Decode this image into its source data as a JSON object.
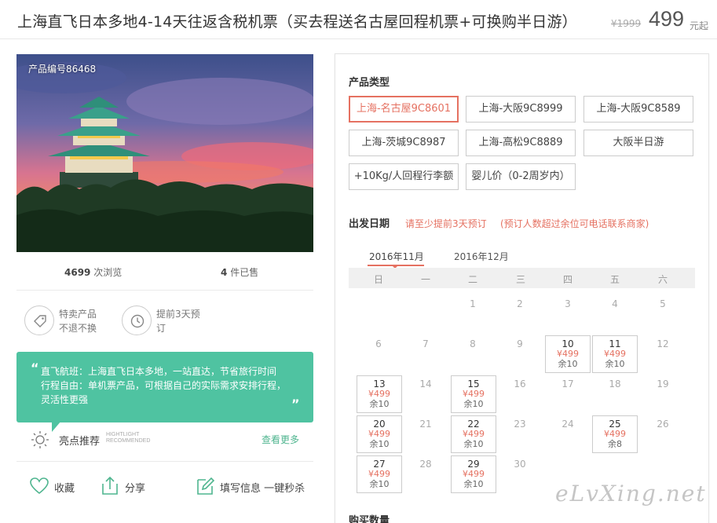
{
  "header": {
    "title": "上海直飞日本多地4-14天往返含税机票（买去程送名古屋回程机票+可换购半日游）",
    "old_price": "¥1999",
    "price": "499",
    "price_unit": "元起"
  },
  "product": {
    "number_label": "产品编号86468",
    "views_count": "4699",
    "views_label": "次浏览",
    "sold_count": "4",
    "sold_label": "件已售"
  },
  "features": [
    {
      "icon": "tag-icon",
      "line1": "特卖产品",
      "line2": "不退不换"
    },
    {
      "icon": "clock-icon",
      "line1": "提前3天预",
      "line2": "订"
    }
  ],
  "highlight": {
    "line1": "直飞航班：上海直飞日本多地，一站直达，节省旅行时间",
    "line2": "行程自由：单机票产品，可根据自己的实际需求安排行程，",
    "line3": "灵活性更强",
    "title": "亮点推荐",
    "title_en_1": "HIGHTLIGHT",
    "title_en_2": "RECOMMENDED",
    "more": "查看更多"
  },
  "actions": {
    "favorite": "收藏",
    "share": "分享",
    "fill_info": "填写信息 一键秒杀"
  },
  "booking": {
    "product_type_title": "产品类型",
    "options": [
      {
        "label": "上海-名古屋9C8601",
        "selected": true
      },
      {
        "label": "上海-大阪9C8999",
        "selected": false
      },
      {
        "label": "上海-大阪9C8589",
        "selected": false
      },
      {
        "label": "上海-茨城9C8987",
        "selected": false
      },
      {
        "label": "上海-高松9C8889",
        "selected": false
      },
      {
        "label": "大阪半日游",
        "selected": false
      },
      {
        "label": "+10Kg/人回程行李额",
        "selected": false
      },
      {
        "label": "婴儿价（0-2周岁内）",
        "selected": false
      }
    ],
    "date_title": "出发日期",
    "date_note1": "请至少提前3天预订",
    "date_note2": "(预订人数超过余位可电话联系商家)",
    "months": [
      "2016年11月",
      "2016年12月"
    ],
    "weekdays": [
      "日",
      "一",
      "二",
      "三",
      "四",
      "五",
      "六"
    ],
    "buy_qty_title": "购买数量"
  },
  "calendar": {
    "plain_days": [
      "1",
      "2",
      "3",
      "4",
      "5",
      "6",
      "7",
      "8",
      "9",
      "12",
      "14",
      "16",
      "17",
      "18",
      "19",
      "21",
      "23",
      "24",
      "26",
      "28",
      "30"
    ],
    "available": [
      {
        "day": "10",
        "price": "¥499",
        "left": "余10"
      },
      {
        "day": "11",
        "price": "¥499",
        "left": "余10"
      },
      {
        "day": "13",
        "price": "¥499",
        "left": "余10"
      },
      {
        "day": "15",
        "price": "¥499",
        "left": "余10"
      },
      {
        "day": "20",
        "price": "¥499",
        "left": "余10"
      },
      {
        "day": "22",
        "price": "¥499",
        "left": "余10"
      },
      {
        "day": "25",
        "price": "¥499",
        "left": "余8"
      },
      {
        "day": "27",
        "price": "¥499",
        "left": "余10"
      },
      {
        "day": "29",
        "price": "¥499",
        "left": "余10"
      }
    ]
  },
  "watermark": "eLvXing.net",
  "colors": {
    "accent": "#e57161",
    "green": "#4fc3a1",
    "link_green": "#4fb58f"
  }
}
